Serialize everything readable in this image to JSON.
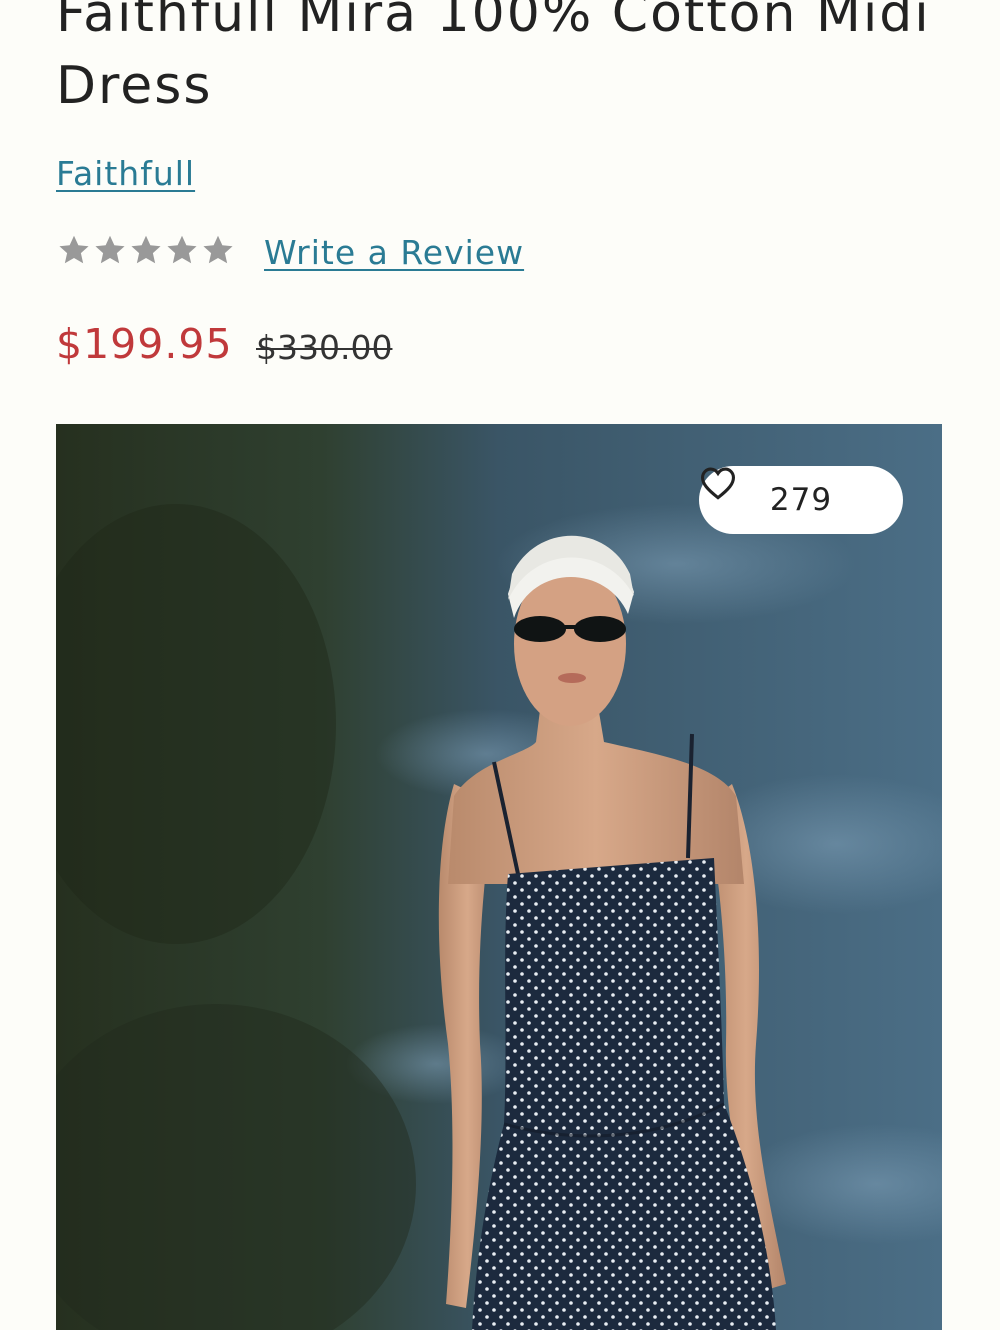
{
  "product": {
    "title": "Faithfull Mira 100% Cotton Midi Dress",
    "brand": "Faithfull",
    "rating": {
      "stars_filled": 0,
      "stars_total": 5
    },
    "write_review_label": "Write a Review",
    "price_sale": "$199.95",
    "price_original": "$330.00"
  },
  "gallery": {
    "like_count": "279",
    "heart_icon": "heart-outline-icon",
    "image_description": "Model wearing navy polka dot midi dress with white headband and dark sunglasses by the water"
  },
  "colors": {
    "link": "#2a7b94",
    "sale_price": "#c0393b",
    "star_empty": "#999999",
    "background": "#fdfdf9"
  }
}
